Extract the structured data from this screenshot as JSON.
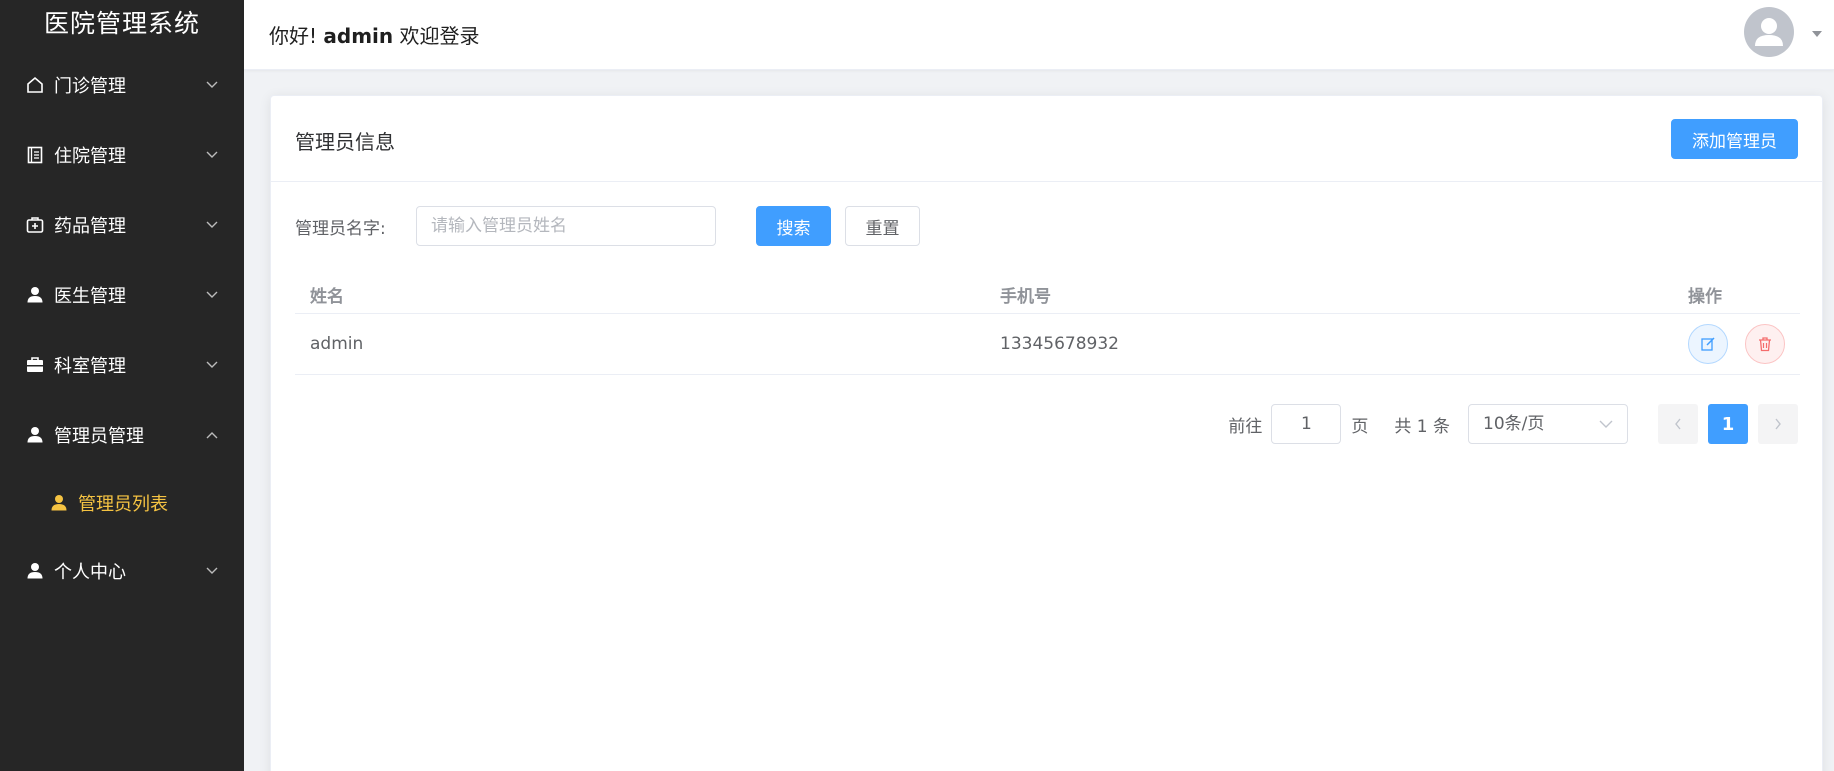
{
  "app": {
    "title": "医院管理系统"
  },
  "sidebar": {
    "items": [
      {
        "label": "门诊管理",
        "icon": "home-icon",
        "expanded": false
      },
      {
        "label": "住院管理",
        "icon": "document-icon",
        "expanded": false
      },
      {
        "label": "药品管理",
        "icon": "medicine-box-icon",
        "expanded": false
      },
      {
        "label": "医生管理",
        "icon": "user-icon",
        "expanded": false
      },
      {
        "label": "科室管理",
        "icon": "briefcase-icon",
        "expanded": false
      },
      {
        "label": "管理员管理",
        "icon": "user-icon",
        "expanded": true
      },
      {
        "label": "个人中心",
        "icon": "user-icon",
        "expanded": false
      }
    ],
    "subitems": [
      {
        "label": "管理员列表",
        "icon": "user-icon",
        "active": true
      }
    ]
  },
  "header": {
    "greeting_prefix": "你好!",
    "username": "admin",
    "greeting_suffix": "欢迎登录"
  },
  "card": {
    "title": "管理员信息",
    "add_button": "添加管理员"
  },
  "search": {
    "label": "管理员名字:",
    "placeholder": "请输入管理员姓名",
    "value": "",
    "search_button": "搜索",
    "reset_button": "重置"
  },
  "table": {
    "columns": [
      "姓名",
      "手机号",
      "操作"
    ],
    "rows": [
      {
        "name": "admin",
        "phone": "13345678932"
      }
    ]
  },
  "pagination": {
    "goto_label": "前往",
    "goto_value": "1",
    "page_unit": "页",
    "total_text": "共 1 条",
    "page_size": "10条/页",
    "current_page": "1"
  },
  "colors": {
    "sidebar_bg": "#262626",
    "active_text": "#f5c342",
    "primary": "#409eff",
    "danger": "#f56c6c"
  }
}
